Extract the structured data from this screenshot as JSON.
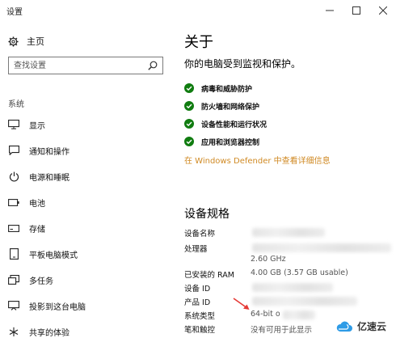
{
  "window": {
    "title": "设置"
  },
  "sidebar": {
    "home_label": "主页",
    "search_placeholder": "查找设置",
    "section_label": "系统",
    "items": [
      {
        "label": "显示",
        "icon": "monitor-icon"
      },
      {
        "label": "通知和操作",
        "icon": "notification-icon"
      },
      {
        "label": "电源和睡眠",
        "icon": "power-icon"
      },
      {
        "label": "电池",
        "icon": "battery-icon"
      },
      {
        "label": "存储",
        "icon": "storage-icon"
      },
      {
        "label": "平板电脑模式",
        "icon": "tablet-icon"
      },
      {
        "label": "多任务",
        "icon": "multitask-icon"
      },
      {
        "label": "投影到这台电脑",
        "icon": "project-icon"
      },
      {
        "label": "共享的体验",
        "icon": "shared-icon"
      }
    ]
  },
  "main": {
    "title": "关于",
    "subtitle": "你的电脑受到监视和保护。",
    "checks": [
      "病毒和威胁防护",
      "防火墙和网络保护",
      "设备性能和运行状况",
      "应用和浏览器控制"
    ],
    "defender_link": "在 Windows Defender 中查看详细信息",
    "specs_title": "设备规格",
    "specs": {
      "device_name_label": "设备名称",
      "processor_label": "处理器",
      "processor_speed": "2.60 GHz",
      "ram_label": "已安装的 RAM",
      "ram_value": "4.00 GB (3.57 GB usable)",
      "device_id_label": "设备 ID",
      "product_id_label": "产品 ID",
      "system_type_label": "系统类型",
      "system_type_value": "64-bit o",
      "pen_label": "笔和触控",
      "pen_value": "没有可用于此显示"
    }
  },
  "brand": {
    "text": "亿速云"
  },
  "colors": {
    "accent": "#d08a24",
    "check": "#107c10"
  }
}
